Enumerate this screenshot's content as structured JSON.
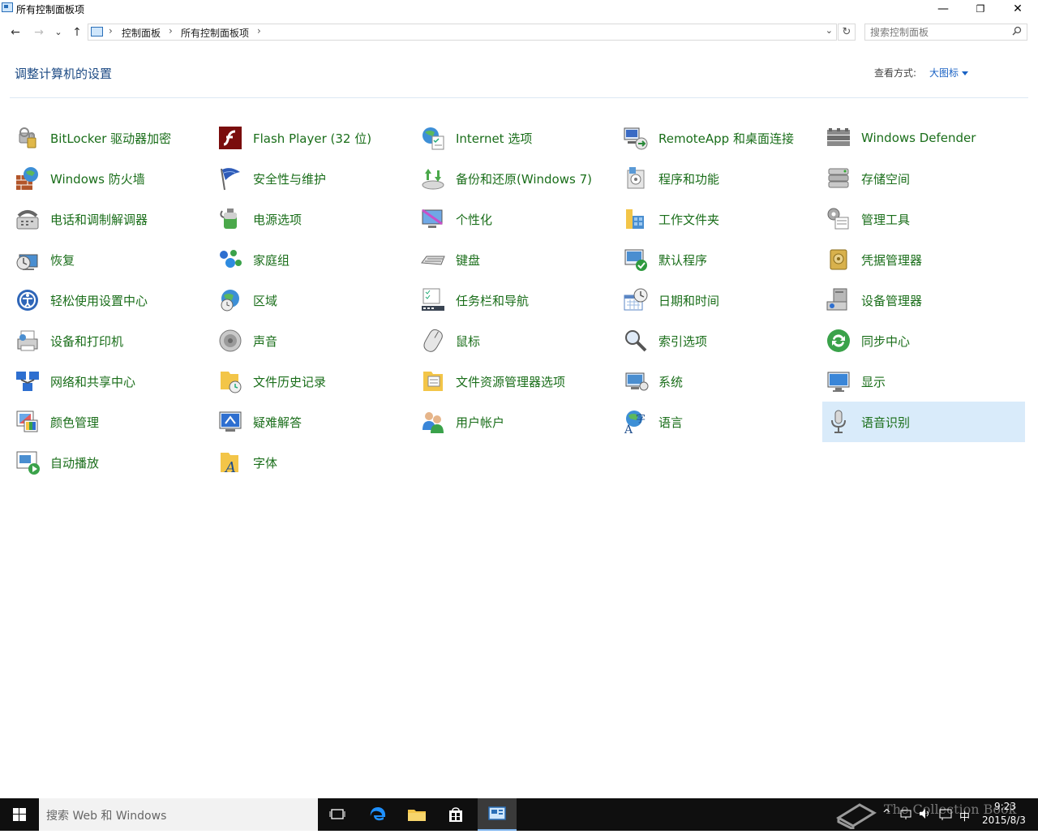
{
  "window": {
    "title": "所有控制面板项",
    "minimize_glyph": "—",
    "maximize_glyph": "❐",
    "close_glyph": "✕"
  },
  "nav": {
    "back_glyph": "←",
    "forward_glyph": "→",
    "recent_glyph": "⌄",
    "up_glyph": "↑",
    "breadcrumb": [
      "控制面板",
      "所有控制面板项"
    ],
    "refresh_glyph": "↻"
  },
  "search": {
    "placeholder": "搜索控制面板"
  },
  "header": {
    "heading": "调整计算机的设置",
    "view_by_label": "查看方式:",
    "view_by_value": "大图标"
  },
  "items": [
    {
      "label": "BitLocker 驱动器加密",
      "icon": "bitlocker-icon"
    },
    {
      "label": "Flash Player (32 位)",
      "icon": "flash-player-icon"
    },
    {
      "label": "Internet 选项",
      "icon": "internet-options-icon"
    },
    {
      "label": "RemoteApp 和桌面连接",
      "icon": "remoteapp-icon"
    },
    {
      "label": "Windows Defender",
      "icon": "windows-defender-icon"
    },
    {
      "label": "Windows 防火墙",
      "icon": "firewall-icon"
    },
    {
      "label": "安全性与维护",
      "icon": "security-flag-icon"
    },
    {
      "label": "备份和还原(Windows 7)",
      "icon": "backup-icon"
    },
    {
      "label": "程序和功能",
      "icon": "programs-icon"
    },
    {
      "label": "存储空间",
      "icon": "storage-spaces-icon"
    },
    {
      "label": "电话和调制解调器",
      "icon": "phone-modem-icon"
    },
    {
      "label": "电源选项",
      "icon": "power-options-icon"
    },
    {
      "label": "个性化",
      "icon": "personalization-icon"
    },
    {
      "label": "工作文件夹",
      "icon": "work-folders-icon"
    },
    {
      "label": "管理工具",
      "icon": "admin-tools-icon"
    },
    {
      "label": "恢复",
      "icon": "recovery-icon"
    },
    {
      "label": "家庭组",
      "icon": "homegroup-icon"
    },
    {
      "label": "键盘",
      "icon": "keyboard-icon"
    },
    {
      "label": "默认程序",
      "icon": "default-programs-icon"
    },
    {
      "label": "凭据管理器",
      "icon": "credential-manager-icon"
    },
    {
      "label": "轻松使用设置中心",
      "icon": "ease-of-access-icon"
    },
    {
      "label": "区域",
      "icon": "region-icon"
    },
    {
      "label": "任务栏和导航",
      "icon": "taskbar-navigation-icon"
    },
    {
      "label": "日期和时间",
      "icon": "date-time-icon"
    },
    {
      "label": "设备管理器",
      "icon": "device-manager-icon"
    },
    {
      "label": "设备和打印机",
      "icon": "devices-printers-icon"
    },
    {
      "label": "声音",
      "icon": "sound-icon"
    },
    {
      "label": "鼠标",
      "icon": "mouse-icon"
    },
    {
      "label": "索引选项",
      "icon": "indexing-options-icon"
    },
    {
      "label": "同步中心",
      "icon": "sync-center-icon"
    },
    {
      "label": "网络和共享中心",
      "icon": "network-sharing-icon"
    },
    {
      "label": "文件历史记录",
      "icon": "file-history-icon"
    },
    {
      "label": "文件资源管理器选项",
      "icon": "explorer-options-icon"
    },
    {
      "label": "系统",
      "icon": "system-icon"
    },
    {
      "label": "显示",
      "icon": "display-icon"
    },
    {
      "label": "颜色管理",
      "icon": "color-management-icon"
    },
    {
      "label": "疑难解答",
      "icon": "troubleshooting-icon"
    },
    {
      "label": "用户帐户",
      "icon": "user-accounts-icon"
    },
    {
      "label": "语言",
      "icon": "language-icon"
    },
    {
      "label": "语音识别",
      "icon": "speech-recognition-icon"
    },
    {
      "label": "自动播放",
      "icon": "autoplay-icon"
    },
    {
      "label": "字体",
      "icon": "fonts-icon"
    }
  ],
  "selected_item": "语音识别",
  "taskbar": {
    "search_placeholder": "搜索 Web 和 Windows",
    "clock_time": "9:23",
    "clock_date": "2015/8/3",
    "ime": "中",
    "watermark": "The Collection Book"
  },
  "colors": {
    "heading": "#1c4a84",
    "item_label": "#1a6e1a",
    "selected_bg": "#d9ebfa",
    "link": "#1a62c4",
    "taskbar_bg": "#0f0f0f"
  }
}
